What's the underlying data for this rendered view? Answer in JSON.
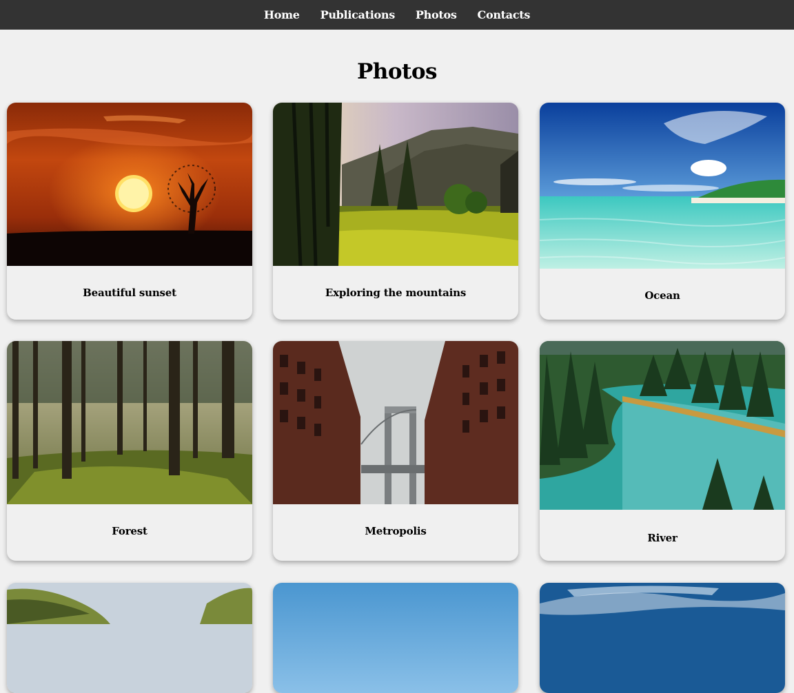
{
  "nav": {
    "items": [
      {
        "label": "Home"
      },
      {
        "label": "Publications"
      },
      {
        "label": "Photos"
      },
      {
        "label": "Contacts"
      }
    ]
  },
  "page": {
    "title": "Photos"
  },
  "photos": [
    {
      "caption": "Beautiful sunset",
      "image": "sunset-tree-image"
    },
    {
      "caption": "Exploring the mountains",
      "image": "mountain-forest-image"
    },
    {
      "caption": "Ocean",
      "image": "tropical-ocean-image"
    },
    {
      "caption": "Forest",
      "image": "forest-image"
    },
    {
      "caption": "Metropolis",
      "image": "city-bridge-image"
    },
    {
      "caption": "River",
      "image": "river-forest-image"
    },
    {
      "caption": "",
      "image": "green-hills-image"
    },
    {
      "caption": "",
      "image": "blue-sky-image"
    },
    {
      "caption": "",
      "image": "cloudy-sky-image"
    }
  ]
}
